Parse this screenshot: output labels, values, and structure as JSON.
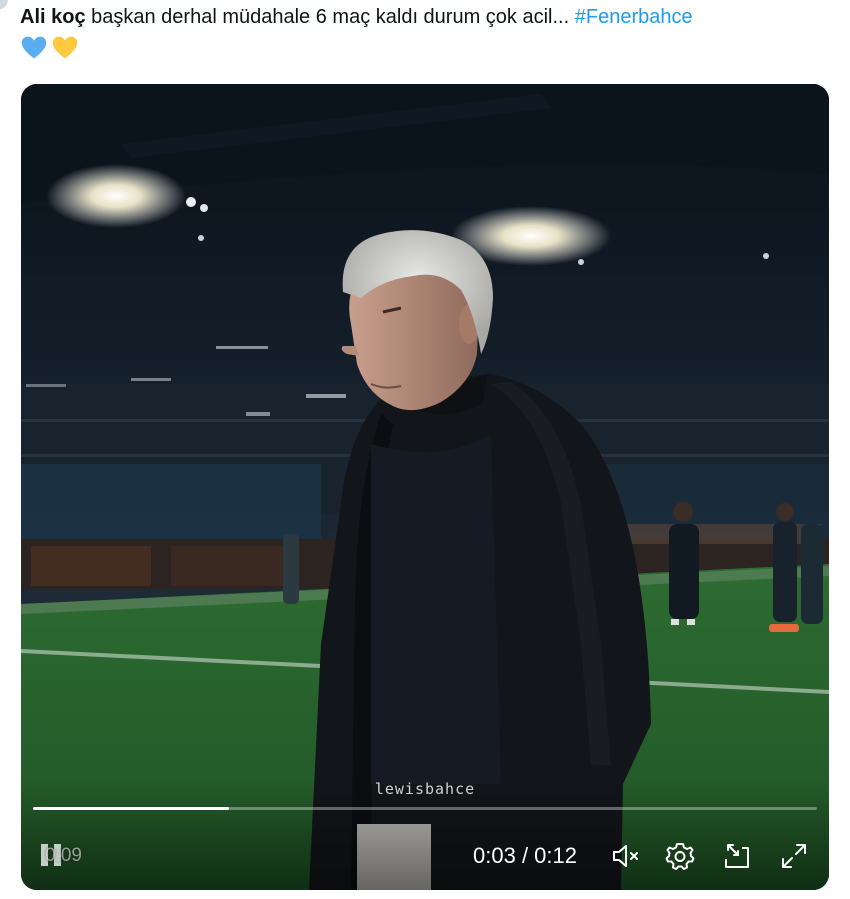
{
  "tweet": {
    "author": "Ali koç",
    "text": " başkan derhal müdahale 6 maç kaldı durum çok acil...",
    "hashtag": "#Fenerbahce",
    "emojis": [
      "blue-heart",
      "yellow-heart"
    ]
  },
  "video": {
    "watermark": "lewisbahce",
    "progress_fraction": 0.25,
    "remaining_time": "0:09",
    "current_time": "0:03",
    "separator": " / ",
    "duration": "0:12",
    "controls": [
      "pause-icon",
      "mute-icon",
      "settings-icon",
      "pip-icon",
      "fullscreen-icon"
    ]
  },
  "colors": {
    "hashtag": "#1d9bf0",
    "blue_heart": "#5aaef0",
    "yellow_heart": "#ffc83d",
    "pitch": "#2f6a2f"
  }
}
